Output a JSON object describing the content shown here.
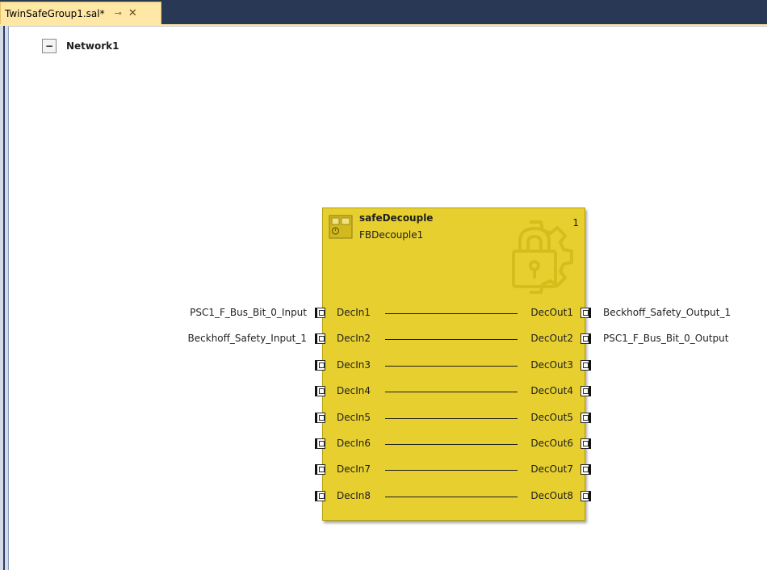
{
  "tab": {
    "title": "TwinSafeGroup1.sal*",
    "pin_glyph": "⊸",
    "close_glyph": "✕"
  },
  "network": {
    "collapse_glyph": "−",
    "label": "Network1"
  },
  "function_block": {
    "type_name": "safeDecouple",
    "instance_name": "FBDecouple1",
    "index": "1",
    "icon": "safety-fb-icon",
    "watermark_icon": "safety-gear-lock-icon"
  },
  "inputs": [
    {
      "port": "DecIn1",
      "connection": "PSC1_F_Bus_Bit_0_Input"
    },
    {
      "port": "DecIn2",
      "connection": "Beckhoff_Safety_Input_1"
    },
    {
      "port": "DecIn3",
      "connection": ""
    },
    {
      "port": "DecIn4",
      "connection": ""
    },
    {
      "port": "DecIn5",
      "connection": ""
    },
    {
      "port": "DecIn6",
      "connection": ""
    },
    {
      "port": "DecIn7",
      "connection": ""
    },
    {
      "port": "DecIn8",
      "connection": ""
    }
  ],
  "outputs": [
    {
      "port": "DecOut1",
      "connection": "Beckhoff_Safety_Output_1"
    },
    {
      "port": "DecOut2",
      "connection": "PSC1_F_Bus_Bit_0_Output"
    },
    {
      "port": "DecOut3",
      "connection": ""
    },
    {
      "port": "DecOut4",
      "connection": ""
    },
    {
      "port": "DecOut5",
      "connection": ""
    },
    {
      "port": "DecOut6",
      "connection": ""
    },
    {
      "port": "DecOut7",
      "connection": ""
    },
    {
      "port": "DecOut8",
      "connection": ""
    }
  ]
}
